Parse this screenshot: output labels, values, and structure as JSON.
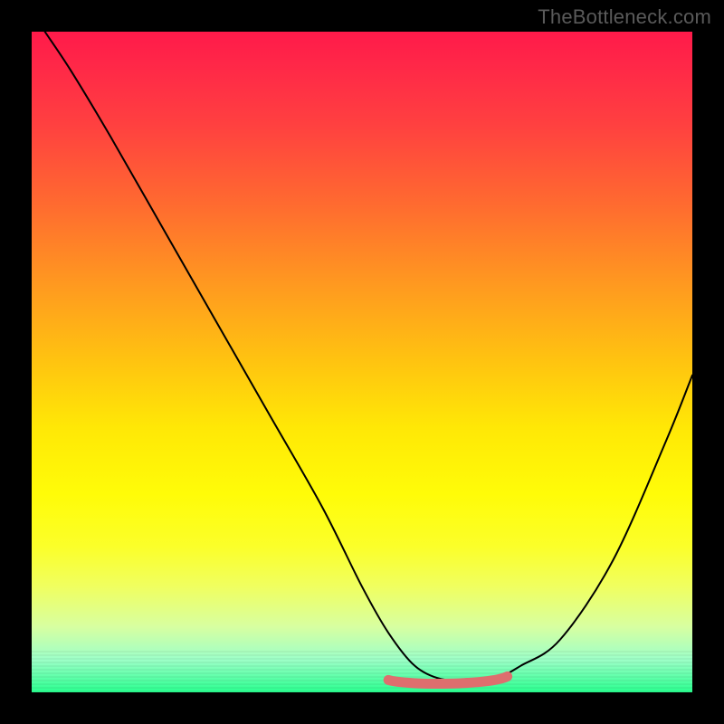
{
  "watermark": "TheBottleneck.com",
  "chart_data": {
    "type": "line",
    "title": "",
    "xlabel": "",
    "ylabel": "",
    "xlim": [
      0,
      100
    ],
    "ylim": [
      0,
      100
    ],
    "series": [
      {
        "name": "curve",
        "x": [
          2,
          6,
          12,
          20,
          28,
          36,
          44,
          50,
          54,
          58,
          62,
          66,
          70,
          74,
          80,
          88,
          96,
          100
        ],
        "values": [
          100,
          94,
          84,
          70,
          56,
          42,
          28,
          16,
          9,
          4,
          2,
          2,
          2,
          4,
          8,
          20,
          38,
          48
        ]
      }
    ],
    "flat_region": {
      "x_start": 54,
      "x_end": 72,
      "y": 2,
      "stroke": "#de6e6e"
    },
    "background_gradient": {
      "top": "#ff1a4a",
      "mid": "#ffe806",
      "bottom": "#2aff90"
    }
  }
}
